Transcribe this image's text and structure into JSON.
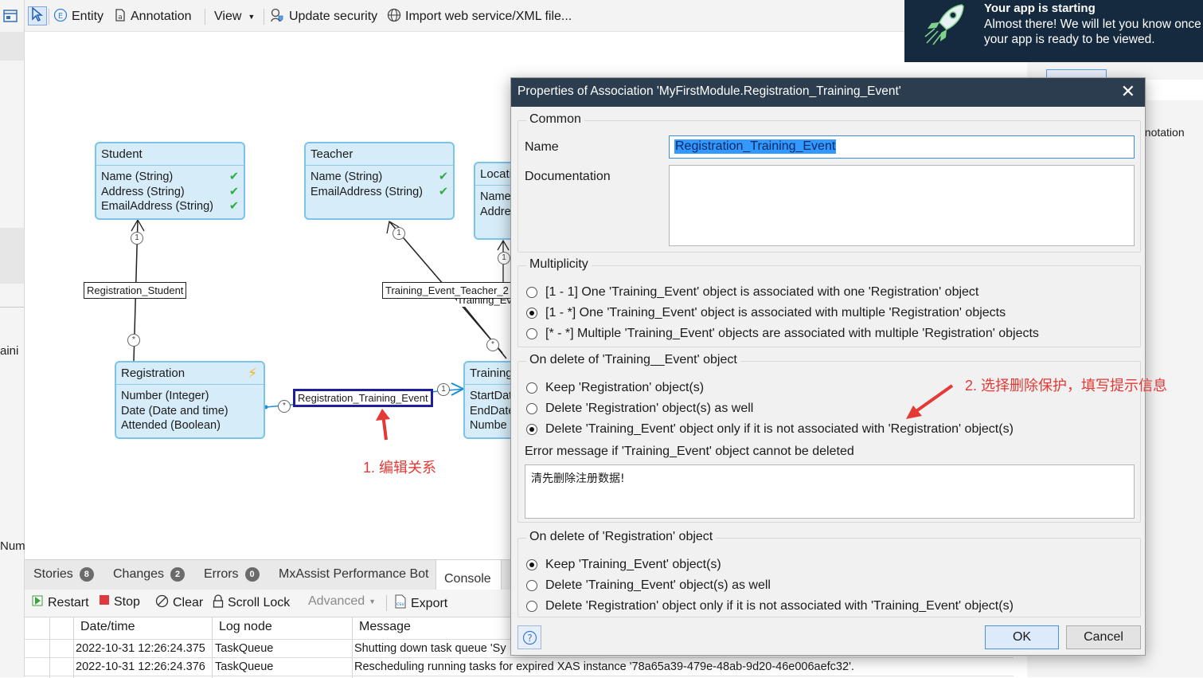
{
  "toolbar": {
    "entity": "Entity",
    "annotation": "Annotation",
    "view": "View",
    "update_security": "Update security",
    "import_web_service": "Import web service/XML file..."
  },
  "left_strip": {
    "cut1": "aini",
    "cut2": "Num"
  },
  "right_panel": {
    "cut_label": "nnotation"
  },
  "toast": {
    "title": "Your app is starting",
    "message": "Almost there! We will let you know once your app is ready to be viewed."
  },
  "entities": {
    "student": {
      "name": "Student",
      "attrs": [
        "Name (String)",
        "Address (String)",
        "EmailAddress (String)"
      ]
    },
    "teacher": {
      "name": "Teacher",
      "attrs": [
        "Name (String)",
        "EmailAddress (String)"
      ]
    },
    "location": {
      "name": "Locati",
      "attrs": [
        "Name",
        "Addre"
      ]
    },
    "registration": {
      "name": "Registration",
      "attrs": [
        "Number (Integer)",
        "Date (Date and time)",
        "Attended (Boolean)"
      ]
    },
    "training": {
      "name": "Training",
      "attrs": [
        "StartDat",
        "EndDate",
        "Numbe"
      ]
    }
  },
  "associations": {
    "registration_student": "Registration_Student",
    "training_event_teacher": "Training_Event_Teacher_2",
    "training_ev_cut": "Training_Ev",
    "registration_training_event": "Registration_Training_Event"
  },
  "multiplicity_marks": {
    "one": "1",
    "many": "*"
  },
  "annotations": {
    "note1": "1. 编辑关系",
    "note2": "2. 选择删除保护，填写提示信息"
  },
  "bottom_tabs": [
    {
      "label": "Stories",
      "badge": "8"
    },
    {
      "label": "Changes",
      "badge": "2"
    },
    {
      "label": "Errors",
      "badge": "0"
    },
    {
      "label": "MxAssist Performance Bot"
    },
    {
      "label": "Console"
    }
  ],
  "console_toolbar": {
    "restart": "Restart",
    "stop": "Stop",
    "clear": "Clear",
    "scroll_lock": "Scroll Lock",
    "advanced": "Advanced",
    "export": "Export"
  },
  "log_table": {
    "columns": [
      "Date/time",
      "Log node",
      "Message"
    ],
    "rows": [
      {
        "datetime": "2022-10-31 12:26:24.375",
        "node": "TaskQueue",
        "message": "Shutting down task queue 'Sy"
      },
      {
        "datetime": "2022-10-31 12:26:24.376",
        "node": "TaskQueue",
        "message": "Rescheduling running tasks for expired XAS instance '78a65a39-479e-48ab-9d20-46e006aefc32'."
      }
    ]
  },
  "dialog": {
    "title": "Properties of Association 'MyFirstModule.Registration_Training_Event'",
    "common": {
      "legend": "Common",
      "name_label": "Name",
      "name_value": "Registration_Training_Event",
      "documentation_label": "Documentation",
      "documentation_value": ""
    },
    "multiplicity": {
      "legend": "Multiplicity",
      "options": [
        "[1 - 1] One 'Training_Event' object is associated with one 'Registration' object",
        "[1 - *] One 'Training_Event' object is associated with multiple 'Registration' objects",
        "[* - *] Multiple 'Training_Event' objects are associated with multiple 'Registration' objects"
      ],
      "selected": 1
    },
    "delete_training": {
      "legend": "On delete of 'Training__Event' object",
      "options": [
        "Keep 'Registration' object(s)",
        "Delete 'Registration' object(s) as well",
        "Delete 'Training_Event' object only if it is not associated with 'Registration' object(s)"
      ],
      "selected": 2,
      "error_label": "Error message if 'Training_Event' object cannot be deleted",
      "error_value": "清先删除注册数据!"
    },
    "delete_registration": {
      "legend": "On delete of 'Registration' object",
      "options": [
        "Keep 'Training_Event' object(s)",
        "Delete 'Training_Event' object(s) as well",
        "Delete 'Registration' object only if it is not associated with 'Training_Event' object(s)"
      ],
      "selected": 0
    },
    "ok": "OK",
    "cancel": "Cancel",
    "help_icon": "question-circle-icon"
  },
  "colors": {
    "entity_fill": "#d6ecf8",
    "entity_border": "#7cc3ea",
    "annotation_red": "#e53935",
    "dialog_title_bg": "#2b3d4f",
    "toast_bg": "#15293f",
    "selection_blue": "#1f1f9c"
  }
}
